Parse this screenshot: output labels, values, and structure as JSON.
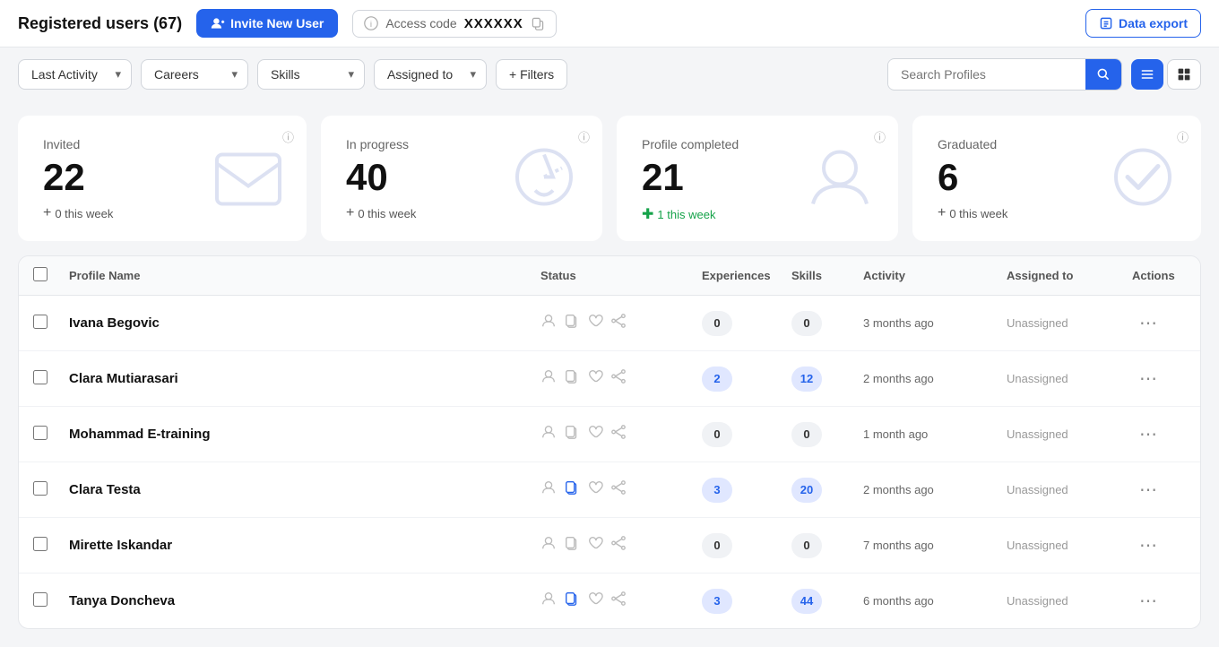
{
  "header": {
    "title": "Registered users (67)",
    "invite_btn": "Invite New User",
    "access_code_label": "Access code",
    "access_code_value": "XXXXXX",
    "data_export_btn": "Data export"
  },
  "filters": {
    "last_activity": "Last Activity",
    "careers": "Careers",
    "skills": "Skills",
    "assigned_to": "Assigned to",
    "filters_btn": "+ Filters",
    "search_placeholder": "Search Profiles"
  },
  "stats": [
    {
      "label": "Invited",
      "value": "22",
      "week": "0 this week",
      "positive": false
    },
    {
      "label": "In progress",
      "value": "40",
      "week": "0 this week",
      "positive": false
    },
    {
      "label": "Profile completed",
      "value": "21",
      "week": "1 this week",
      "positive": true
    },
    {
      "label": "Graduated",
      "value": "6",
      "week": "0 this week",
      "positive": false
    }
  ],
  "table": {
    "columns": [
      "Profile Name",
      "Status",
      "Experiences",
      "Skills",
      "Activity",
      "Assigned to",
      "Actions"
    ],
    "rows": [
      {
        "name": "Ivana Begovic",
        "experiences": "0",
        "skills": "0",
        "activity": "3 months ago",
        "assigned": "Unassigned",
        "icon_active": ""
      },
      {
        "name": "Clara Mutiarasari",
        "experiences": "2",
        "skills": "12",
        "activity": "2 months ago",
        "assigned": "Unassigned",
        "icon_active": ""
      },
      {
        "name": "Mohammad E-training",
        "experiences": "0",
        "skills": "0",
        "activity": "1 month ago",
        "assigned": "Unassigned",
        "icon_active": ""
      },
      {
        "name": "Clara Testa",
        "experiences": "3",
        "skills": "20",
        "activity": "2 months ago",
        "assigned": "Unassigned",
        "icon_active": "copy"
      },
      {
        "name": "Mirette Iskandar",
        "experiences": "0",
        "skills": "0",
        "activity": "7 months ago",
        "assigned": "Unassigned",
        "icon_active": ""
      },
      {
        "name": "Tanya Doncheva",
        "experiences": "3",
        "skills": "44",
        "activity": "6 months ago",
        "assigned": "Unassigned",
        "icon_active": "copy"
      }
    ]
  }
}
